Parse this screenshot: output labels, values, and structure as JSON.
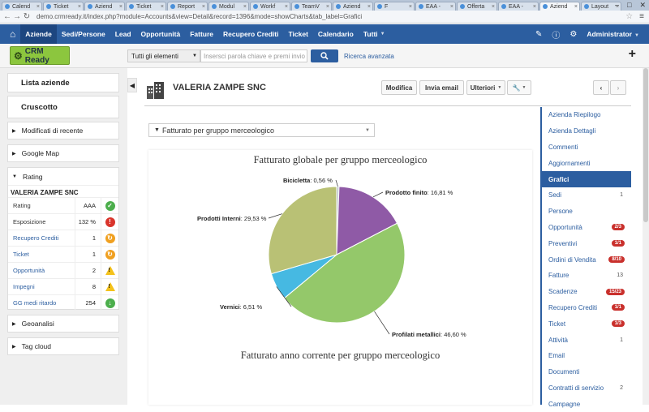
{
  "browser": {
    "tabs": [
      {
        "label": "Calend"
      },
      {
        "label": "Ticket"
      },
      {
        "label": "Aziend"
      },
      {
        "label": "Ticket"
      },
      {
        "label": "Report"
      },
      {
        "label": "Modul"
      },
      {
        "label": "Workf"
      },
      {
        "label": "TeamV"
      },
      {
        "label": "Aziend"
      },
      {
        "label": "F"
      },
      {
        "label": "EAA -"
      },
      {
        "label": "Offerta"
      },
      {
        "label": "EAA -"
      },
      {
        "label": "Aziend"
      },
      {
        "label": "Layout"
      }
    ],
    "active_tab": 13,
    "url": "demo.crmready.it/index.php?module=Accounts&view=Detail&record=1396&mode=showCharts&tab_label=Grafici"
  },
  "topnav": {
    "items": [
      "Aziende",
      "Sedi/Persone",
      "Lead",
      "Opportunità",
      "Fatture",
      "Recupero Crediti",
      "Ticket",
      "Calendario",
      "Tutti"
    ],
    "active": "Aziende",
    "user": "Administrator"
  },
  "toolbar": {
    "logo_text": "CRM Ready",
    "filter_value": "Tutti gli elementi",
    "search_placeholder": "Insersci parola chiave e premi invio",
    "advanced_search": "Ricerca avanzata"
  },
  "sidebar": {
    "lista": "Lista aziende",
    "cruscotto": "Cruscotto",
    "recent": "Modificati di recente",
    "googlemap": "Google Map",
    "rating_section": "Rating",
    "company": "VALERIA ZAMPE SNC",
    "rows": [
      {
        "label": "Rating",
        "value": "AAA",
        "status": "ok",
        "link": false
      },
      {
        "label": "Esposizione",
        "value": "132 %",
        "status": "alert",
        "link": false
      },
      {
        "label": "Recupero Crediti",
        "value": "1",
        "status": "sync",
        "link": true
      },
      {
        "label": "Ticket",
        "value": "1",
        "status": "sync",
        "link": true
      },
      {
        "label": "Opportunità",
        "value": "2",
        "status": "warn",
        "link": true
      },
      {
        "label": "Impegni",
        "value": "8",
        "status": "warn",
        "link": true
      },
      {
        "label": "GG medi ritardo",
        "value": "254",
        "status": "down",
        "link": true
      }
    ],
    "geoanalisi": "Geoanalisi",
    "tagcloud": "Tag cloud"
  },
  "record": {
    "name": "VALERIA ZAMPE SNC",
    "buttons": [
      "Modifica",
      "Invia email",
      "Ulteriori"
    ]
  },
  "chart_filter": "Fatturato per gruppo merceologico",
  "chart_data": [
    {
      "type": "pie",
      "title": "Fatturato globale per gruppo merceologico",
      "categories": [
        "Bicicletta",
        "Prodotto finito",
        "Profilati metallici",
        "Vernici",
        "Prodotti Interni"
      ],
      "values": [
        0.56,
        16.81,
        46.6,
        6.51,
        29.53
      ],
      "value_labels": [
        "0,56 %",
        "16,81 %",
        "46,60 %",
        "6,51 %",
        "29,53 %"
      ],
      "colors": [
        "#bcc5cc",
        "#8f5aa6",
        "#94c86a",
        "#46b9e2",
        "#b9c175"
      ]
    },
    {
      "type": "pie",
      "title": "Fatturato anno corrente per gruppo merceologico"
    }
  ],
  "rightnav": [
    {
      "label": "Azienda Riepilogo"
    },
    {
      "label": "Azienda Dettagli"
    },
    {
      "label": "Commenti"
    },
    {
      "label": "Aggiornamenti"
    },
    {
      "label": "Grafici",
      "active": true
    },
    {
      "label": "Sedi",
      "count": "1"
    },
    {
      "label": "Persone"
    },
    {
      "label": "Opportunità",
      "badge": "2/3"
    },
    {
      "label": "Preventivi",
      "badge": "1/1"
    },
    {
      "label": "Ordini di Vendita",
      "badge": "8/10"
    },
    {
      "label": "Fatture",
      "count": "13"
    },
    {
      "label": "Scadenze",
      "badge": "15/23"
    },
    {
      "label": "Recupero Crediti",
      "badge": "1/1"
    },
    {
      "label": "Ticket",
      "badge": "1/3"
    },
    {
      "label": "Attività",
      "count": "1"
    },
    {
      "label": "Email"
    },
    {
      "label": "Documenti"
    },
    {
      "label": "Contratti di servizio",
      "count": "2"
    },
    {
      "label": "Campagne"
    }
  ]
}
